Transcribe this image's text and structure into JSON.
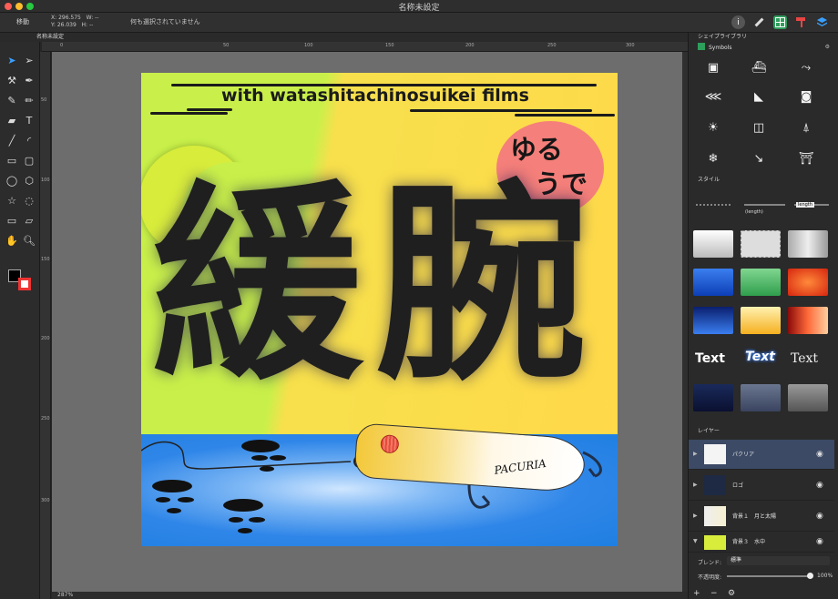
{
  "window": {
    "title": "名称未設定"
  },
  "toolbar": {
    "mode": "移動",
    "x_label": "X:",
    "x_value": "296.575",
    "y_label": "Y:",
    "y_value": "26.039",
    "w_label": "W:",
    "w_value": "--",
    "h_label": "H:",
    "h_value": "--",
    "status": "何も選択されていません"
  },
  "document_tab": "名称未設定",
  "ruler_labels": [
    "0",
    "50",
    "100",
    "150",
    "200",
    "250",
    "300"
  ],
  "vruler_labels": [
    "50",
    "100",
    "150",
    "200",
    "250",
    "300"
  ],
  "artwork": {
    "headline": "with watashitachinosuikei films",
    "sun_line1": "ゆる",
    "sun_line2": "うで",
    "kanji1": "緩",
    "kanji2": "腕",
    "lure_text": "PACURIA"
  },
  "zoom": "287%",
  "panel": {
    "library_title": "シェイプライブラリ",
    "library_select": "Symbols",
    "styles_title": "スタイル",
    "style_length_label": "(length)",
    "style_length_tag": "length",
    "text_styles": [
      "Text",
      "Text",
      "Text"
    ],
    "layers_title": "レイヤー",
    "layers": [
      {
        "name": "パクリア",
        "selected": true
      },
      {
        "name": "ロゴ",
        "selected": false
      },
      {
        "name": "背景１　月と太陽",
        "selected": false
      },
      {
        "name": "背景３　水中",
        "selected": false
      }
    ],
    "blend_label": "ブレンド:",
    "blend_value": "標準",
    "opacity_label": "不透明度:",
    "opacity_value": "100%"
  },
  "colors": {
    "accent_selected_layer": "#3c4a66",
    "sky_green": "#c9f04a",
    "sky_yellow": "#ffd94a",
    "water_blue": "#1f7fe2",
    "sun_pink": "#f57f7a"
  }
}
